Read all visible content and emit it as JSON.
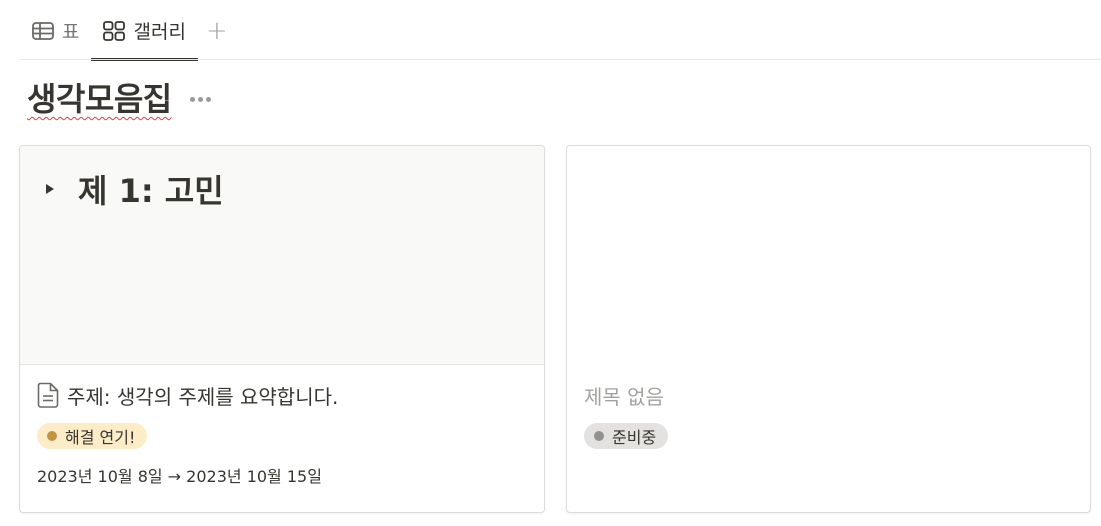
{
  "tabs": [
    {
      "label": "표",
      "icon": "table-icon",
      "active": false
    },
    {
      "label": "갤러리",
      "icon": "gallery-icon",
      "active": true
    }
  ],
  "add_tab_symbol": "+",
  "page": {
    "title": "생각모음집"
  },
  "cards": [
    {
      "cover_text": "제 1: 고민",
      "title": "주제: 생각의 주제를 요약합니다.",
      "tag": {
        "label": "해결 연기!",
        "color": "#fdecc8",
        "dot": "#c29343"
      },
      "date": "2023년 10월 8일 → 2023년 10월 15일"
    },
    {
      "cover_text": "",
      "title": "제목 없음",
      "tag": {
        "label": "준비중",
        "color": "#e3e2e0",
        "dot": "#91918e"
      },
      "date": ""
    }
  ]
}
